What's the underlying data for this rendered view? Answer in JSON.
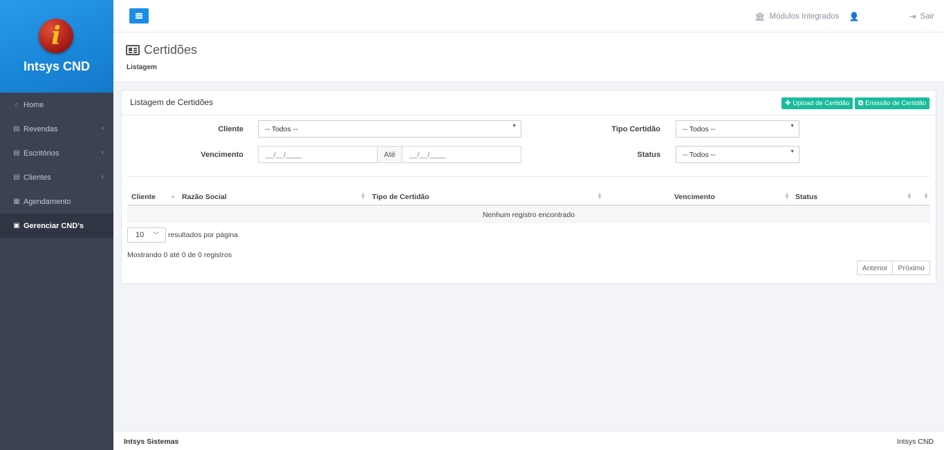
{
  "app": {
    "name": "Intsys CND",
    "logo_letter": "i"
  },
  "sidebar": {
    "items": [
      {
        "label": "Home",
        "icon": "home-icon",
        "has_submenu": false
      },
      {
        "label": "Revendas",
        "icon": "building-icon",
        "has_submenu": true
      },
      {
        "label": "Escritórios",
        "icon": "building-icon",
        "has_submenu": true
      },
      {
        "label": "Clientes",
        "icon": "building-icon",
        "has_submenu": true
      },
      {
        "label": "Agendamento",
        "icon": "calendar-icon",
        "has_submenu": false
      },
      {
        "label": "Gerenciar CND's",
        "icon": "id-card-icon",
        "has_submenu": false,
        "active": true
      }
    ]
  },
  "header": {
    "modules_label": "Módulos Integrados",
    "logout_label": "Sair"
  },
  "page": {
    "title": "Certidões",
    "subtitle": "Listagem"
  },
  "card": {
    "title": "Listagem de Certidões",
    "upload_label": "Upload de Certidão",
    "emit_label": "Emissão de Certidão"
  },
  "filters": {
    "cliente_label": "Cliente",
    "cliente_value": "-- Todos --",
    "tipo_label": "Tipo Certidão",
    "tipo_value": "-- Todos --",
    "vencimento_label": "Vencimento",
    "date_from": "__/__/____",
    "ate_label": "Até",
    "date_to": "__/__/____",
    "status_label": "Status",
    "status_value": "-- Todos --"
  },
  "table": {
    "columns": [
      "Cliente",
      "Razão Social",
      "Tipo de Certidão",
      "Vencimento",
      "Status"
    ],
    "empty_message": "Nenhum registro encontrado"
  },
  "pagination": {
    "page_size": "10",
    "page_size_suffix": "resultados por página",
    "info": "Mostrando 0 até 0 de 0 registros",
    "prev_label": "Anterior",
    "next_label": "Próximo"
  },
  "footer": {
    "left": "Intsys Sistemas",
    "right": "Intsys CND"
  },
  "colors": {
    "accent_blue": "#1a8ee6",
    "sidebar_bg": "#3b4252",
    "green_button": "#1abc9c"
  }
}
